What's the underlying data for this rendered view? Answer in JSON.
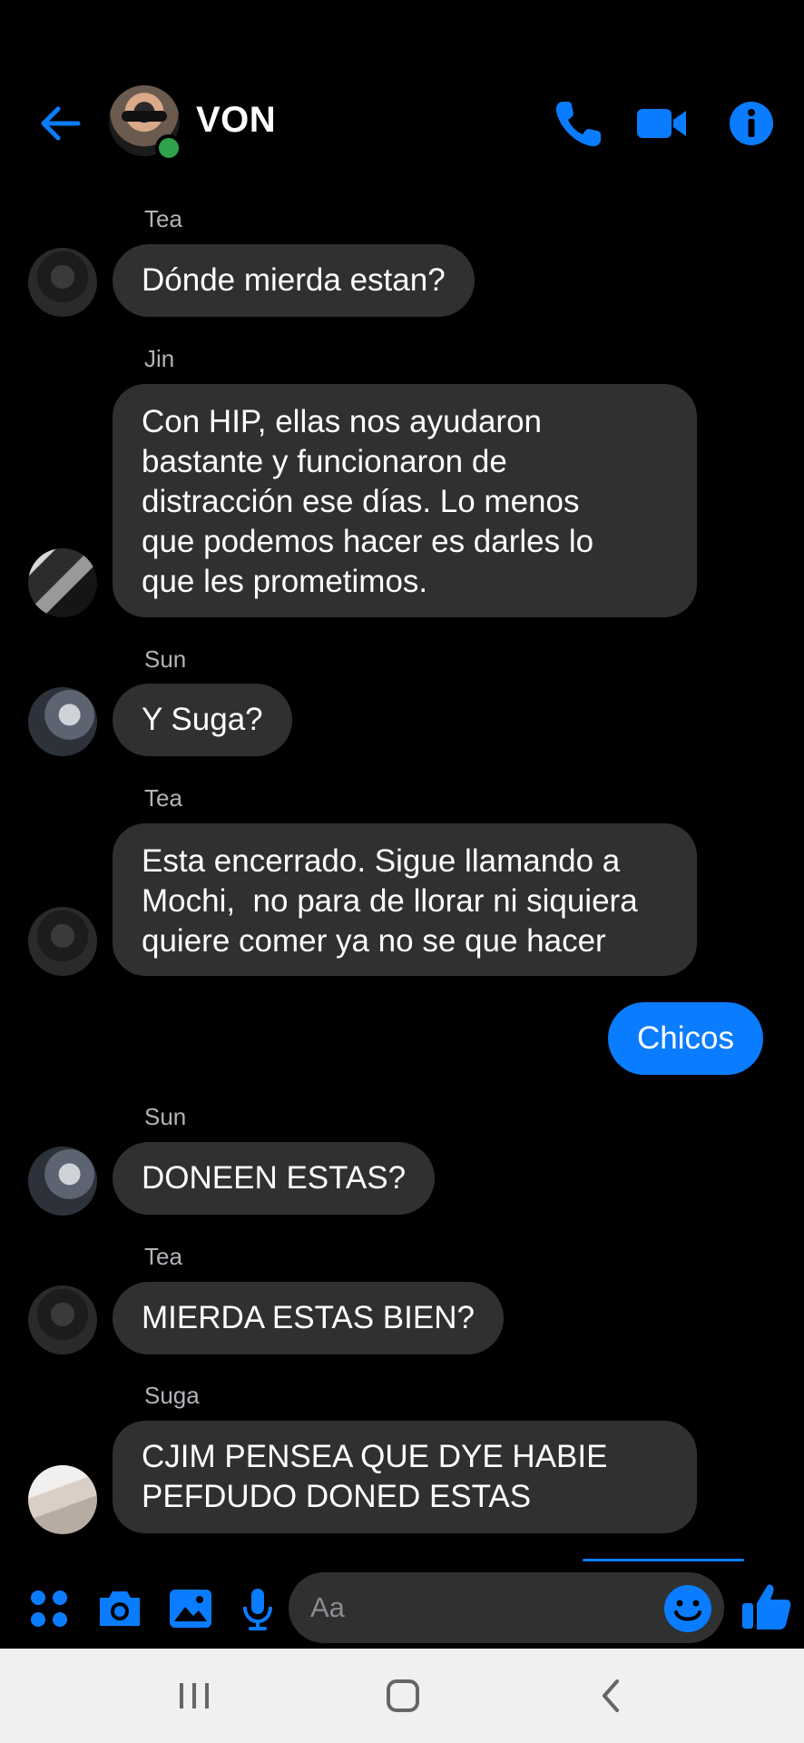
{
  "header": {
    "contact_name": "VON",
    "back_icon": "arrow-left-icon",
    "call_icon": "phone-icon",
    "video_icon": "video-camera-icon",
    "info_icon": "info-icon",
    "online": true
  },
  "messages": [
    {
      "sender": "Tea",
      "text": "Dónde mierda estan?"
    },
    {
      "sender": "Jin",
      "text": "Con HIP, ellas nos ayudaron\nbastante y funcionaron de\ndistracción ese días. Lo menos\nque podemos hacer es darles lo\nque les prometimos."
    },
    {
      "sender": "Sun",
      "text": "Y Suga?"
    },
    {
      "sender": "Tea",
      "text": "Esta encerrado. Sigue llamando a\nMochi,  no para de llorar ni siquiera\nquiere comer ya no se que hacer"
    },
    {
      "sender": "",
      "text": "Chicos",
      "outgoing": true
    },
    {
      "sender": "Sun",
      "text": "DONEEN ESTAS?"
    },
    {
      "sender": "Tea",
      "text": "MIERDA ESTAS BIEN?"
    },
    {
      "sender": "Suga",
      "text": "CJIM PENSEA QUE DYE HABIE\nPEFDUDO DONED ESTAS"
    }
  ],
  "composer": {
    "placeholder": "Aa",
    "value": ""
  },
  "colors": {
    "accent": "#0a7cff",
    "incoming_bubble": "#303030",
    "background": "#000000",
    "online": "#31a24c"
  }
}
